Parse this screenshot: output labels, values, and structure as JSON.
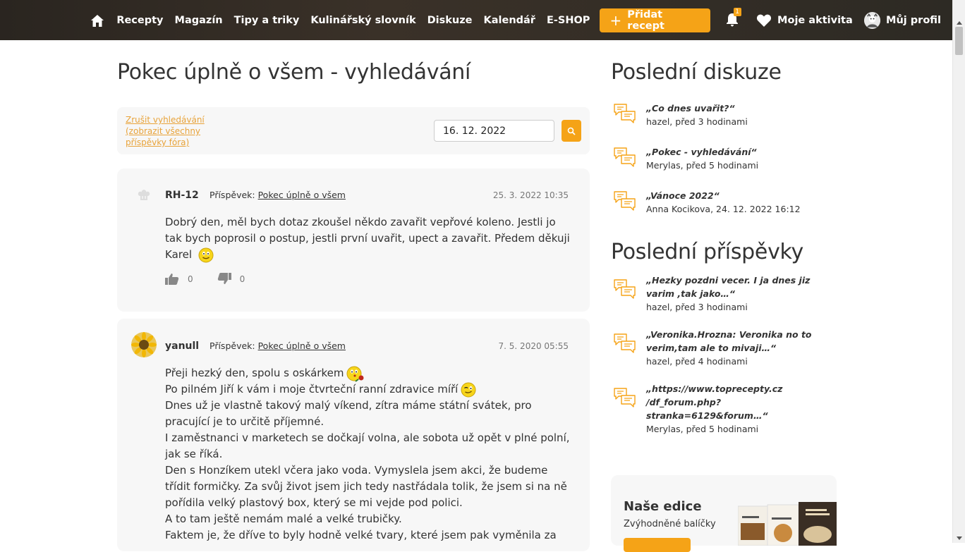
{
  "nav": {
    "items": [
      "Recepty",
      "Magazín",
      "Tipy a triky",
      "Kulinářský slovník",
      "Diskuze",
      "Kalendář",
      "E-SHOP"
    ],
    "add_recipe": "Přidat recept",
    "notifications_count": "1",
    "activity": "Moje aktivita",
    "profile": "Můj profil"
  },
  "page": {
    "title": "Pokec úplně o všem - vyhledávání"
  },
  "search": {
    "cancel_link": "Zrušit vyhledávání (zobrazit všechny příspěvky fóra)",
    "date_value": "16. 12. 2022"
  },
  "posts": [
    {
      "author": "RH-12",
      "label": "Příspěvek:",
      "topic": "Pokec úplně o všem",
      "date": "25. 3. 2022 10:35",
      "body": "Dobrý den, měl bych dotaz zkoušel někdo zavařit vepřové koleno. Jestli jo tak bych poprosil o postup, jestli první uvařit, upect a zavařit. Předem děkuji Karel",
      "likes": "0",
      "dislikes": "0"
    },
    {
      "author": "yanull",
      "label": "Příspěvek:",
      "topic": "Pokec úplně o všem",
      "date": "7. 5. 2020 05:55",
      "lines": [
        "Přeji hezký den, spolu s oskárkem",
        "Po pilném Jiří k vám i moje čtvrteční ranní zdravice míří",
        "Dnes už je vlastně takový malý víkend, zítra máme státní svátek, pro pracující je to určitě příjemné.",
        "I zaměstnanci v marketech se dočkají volna, ale sobota už opět v plné polní, jak se říká.",
        "Den s Honzíkem utekl včera jako voda. Vymyslela jsem akci, že budeme třídit formičky. Za svůj život jsem jich tedy nastřádala tolik, že jsem si na ně pořídila velký plastový box, který se mi vejde pod polici.",
        "A to tam ještě nemám malé a velké trubičky.",
        "Faktem je, že dříve to byly hodně velké tvary, které jsem pak vyměnila za"
      ]
    }
  ],
  "sidebar": {
    "discussions_title": "Poslední diskuze",
    "discussions": [
      {
        "title": "„Co dnes uvařit?“",
        "meta": "hazel, před 3 hodinami"
      },
      {
        "title": "„Pokec - vyhledávání“",
        "meta": "Merylas, před 5 hodinami"
      },
      {
        "title": "„Vánoce 2022“",
        "meta": "Anna Kocikova, 24. 12. 2022 16:12"
      }
    ],
    "posts_title": "Poslední příspěvky",
    "posts": [
      {
        "title": "„Hezky pozdni vecer. I ja dnes jiz varim ,tak jako…“",
        "meta": "hazel, před 3 hodinami"
      },
      {
        "title": "„Veronika.Hrozna: Veronika no to verim,tam ale to mivaji…“",
        "meta": "hazel, před 4 hodinami"
      },
      {
        "title": "„https://www.toprecepty.cz /df_forum.php?stranka=6129&forum…“",
        "meta": "Merylas, před 5 hodinami"
      }
    ],
    "edice_title": "Naše edice",
    "edice_subtitle": "Zvýhodněné balíčky"
  },
  "colors": {
    "accent": "#f5a317",
    "link": "#e8a33a",
    "topbar": "#2f2a24"
  }
}
